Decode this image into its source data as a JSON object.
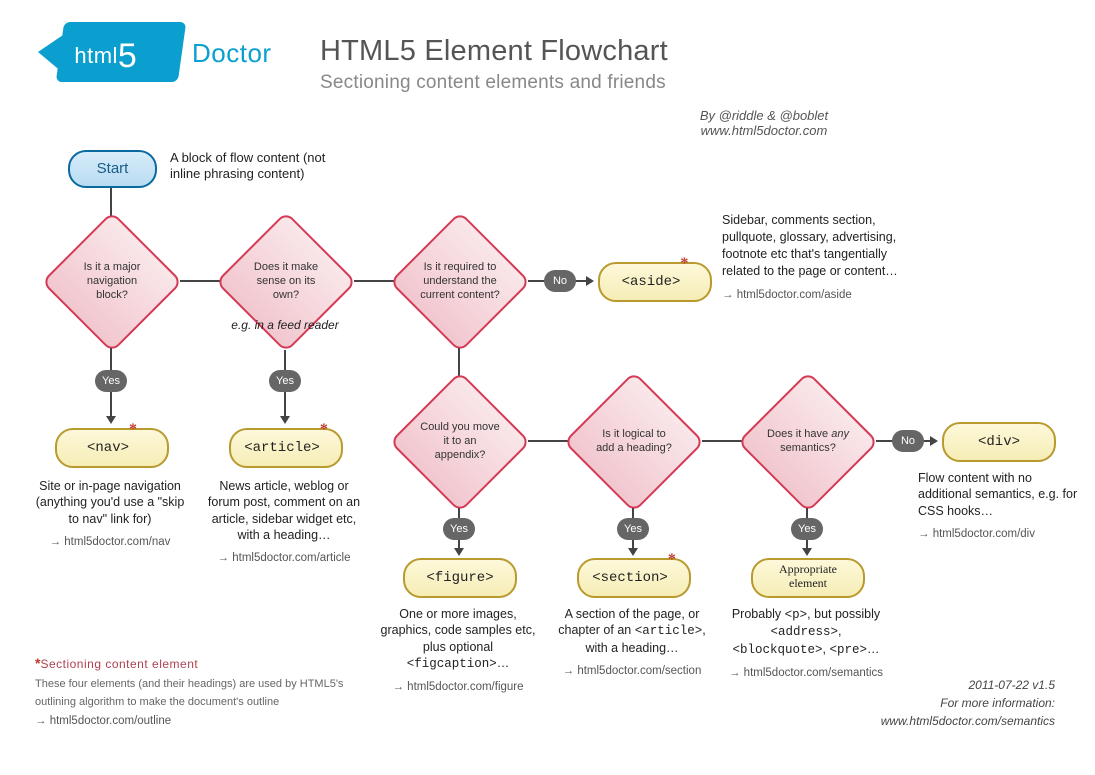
{
  "header": {
    "logo_text": "html",
    "logo_digit": "5",
    "doctor": "Doctor",
    "title": "HTML5 Element Flowchart",
    "subtitle": "Sectioning content elements and friends",
    "byline_a": "By @riddle & @boblet",
    "byline_b": "www.html5doctor.com"
  },
  "start": {
    "label": "Start",
    "note": "A block of flow content (not inline phrasing content)"
  },
  "d1": {
    "q": "Is it a major navigation block?",
    "yes": "Yes"
  },
  "d2": {
    "q": "Does it make sense on its own?",
    "yes": "Yes",
    "note": "e.g. in a feed reader"
  },
  "d3": {
    "q": "Is it required to understand the current content?",
    "no": "No"
  },
  "d4": {
    "q": "Could you move it to an appendix?",
    "yes": "Yes"
  },
  "d5": {
    "q": "Is it logical to add a heading?",
    "yes": "Yes"
  },
  "d6": {
    "q": "Does it have any semantics?",
    "yes": "Yes",
    "no": "No"
  },
  "r_nav": {
    "el": "<nav>",
    "desc": "Site or in-page navigation (anything you'd use a \"skip to nav\" link for)",
    "link": "→ html5doctor.com/nav"
  },
  "r_article": {
    "el": "<article>",
    "desc": "News article, weblog or forum post, comment on an article, sidebar widget etc, with a heading…",
    "link": "→ html5doctor.com/article"
  },
  "r_aside": {
    "el": "<aside>",
    "desc": "Sidebar, comments section, pullquote, glossary, advertising, footnote etc that's tangentially related to the page or content…",
    "link": "→ html5doctor.com/aside"
  },
  "r_figure": {
    "el": "<figure>",
    "desc": "One or more images, graphics, code samples etc, plus optional <figcaption>…",
    "link": "→ html5doctor.com/figure"
  },
  "r_section": {
    "el": "<section>",
    "desc": "A section of the page, or chapter of an <article>, with a heading…",
    "link": "→ html5doctor.com/section"
  },
  "r_appropriate": {
    "el": "Appropriate element",
    "desc": "Probably <p>, but possibly <address>, <blockquote>, <pre>…",
    "link": "→ html5doctor.com/semantics"
  },
  "r_div": {
    "el": "<div>",
    "desc": "Flow content with no additional semantics, e.g. for CSS hooks…",
    "link": "→ html5doctor.com/div"
  },
  "footnote": {
    "title": "Sectioning content element",
    "body": "These four elements (and their headings) are used by HTML5's outlining algorithm to make the document's outline",
    "link": "→ html5doctor.com/outline"
  },
  "meta": {
    "a": "2011-07-22 v1.5",
    "b": "For more information:",
    "c": "www.html5doctor.com/semantics"
  }
}
